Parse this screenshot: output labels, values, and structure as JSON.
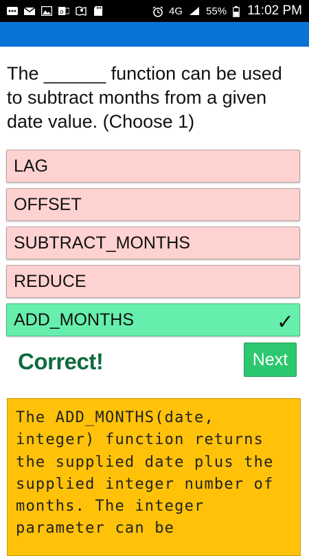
{
  "status_bar": {
    "battery": "55%",
    "time": "11:02 PM",
    "network": "4G",
    "left_icons": [
      "more-icon",
      "mail-icon",
      "image-icon",
      "outlook-icon",
      "maps-icon",
      "sd-card-icon"
    ],
    "right_icons": [
      "alarm-icon",
      "lte-icon",
      "signal-icon",
      "battery-icon"
    ]
  },
  "app_bar": {
    "color": "#0a73d6"
  },
  "question": {
    "text": "The ______ function can be used to subtract months from a given date value. (Choose 1)"
  },
  "options": [
    {
      "label": "LAG",
      "state": "incorrect"
    },
    {
      "label": "OFFSET",
      "state": "incorrect"
    },
    {
      "label": "SUBTRACT_MONTHS",
      "state": "incorrect"
    },
    {
      "label": "REDUCE",
      "state": "incorrect"
    },
    {
      "label": "ADD_MONTHS",
      "state": "correct",
      "mark": "✓"
    }
  ],
  "result": {
    "text": "Correct!",
    "next_label": "Next"
  },
  "explanation": {
    "text": "The ADD_MONTHS(date, integer) function returns the supplied date plus the supplied integer number of months. The integer parameter can be"
  },
  "colors": {
    "incorrect_bg": "#fdd2d0",
    "correct_bg": "#66efac",
    "next_bg": "#2bc86f",
    "explanation_bg": "#ffc208",
    "result_text": "#0f6b3e"
  }
}
